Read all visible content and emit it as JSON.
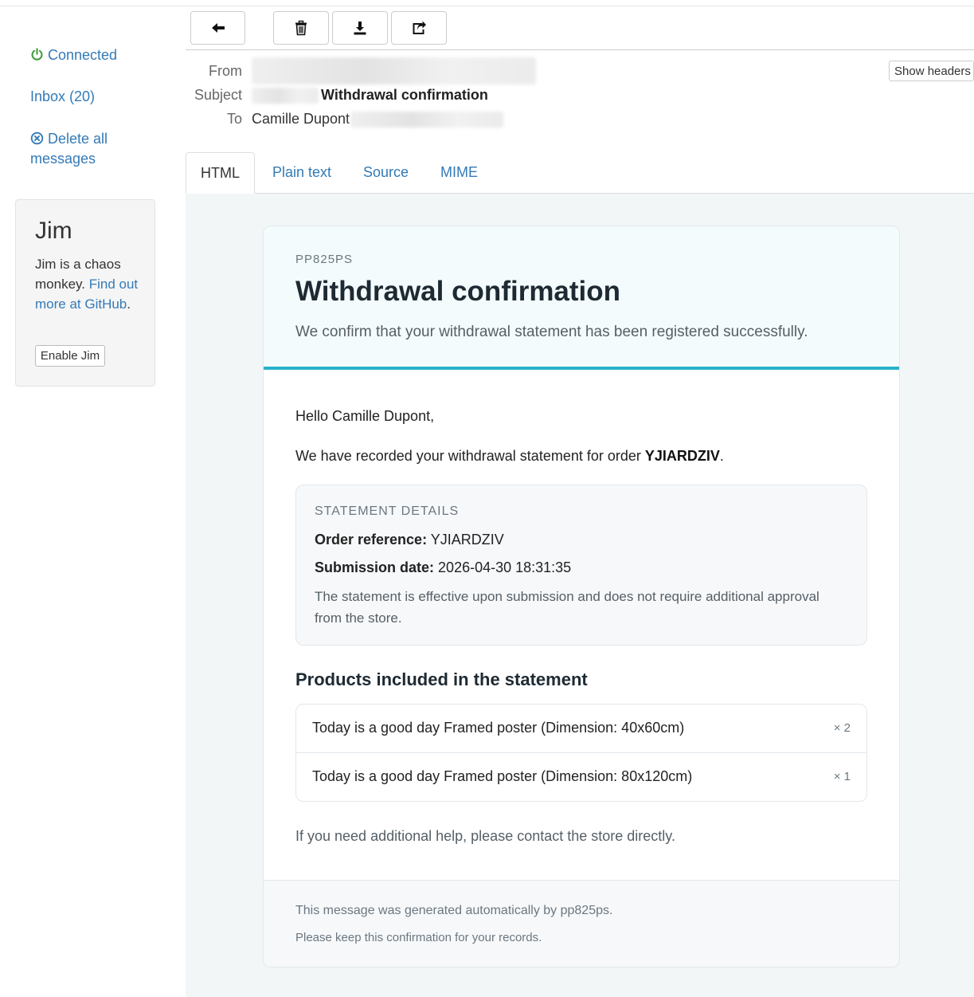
{
  "sidebar": {
    "connected": "Connected",
    "inbox": "Inbox (20)",
    "delete_all": "Delete all messages",
    "jim": {
      "title": "Jim",
      "desc": "Jim is a chaos monkey.",
      "link": "Find out more at GitHub",
      "link_suffix": ".",
      "button": "Enable Jim"
    }
  },
  "toolbar": {
    "back_icon": "arrow-left-icon",
    "delete_icon": "trash-icon",
    "download_icon": "download-icon",
    "share_icon": "share-icon"
  },
  "headers": {
    "from_label": "From",
    "subject_label": "Subject",
    "to_label": "To",
    "subject": "Withdrawal confirmation",
    "to_name": "Camille Dupont",
    "show_headers": "Show headers"
  },
  "tabs": [
    {
      "label": "HTML",
      "active": true
    },
    {
      "label": "Plain text",
      "active": false
    },
    {
      "label": "Source",
      "active": false
    },
    {
      "label": "MIME",
      "active": false
    }
  ],
  "email": {
    "brand": "PP825PS",
    "title": "Withdrawal confirmation",
    "lead": "We confirm that your withdrawal statement has been registered successfully.",
    "greeting": "Hello Camille Dupont,",
    "recorded_prefix": "We have recorded your withdrawal statement for order ",
    "order_code": "YJIARDZIV",
    "recorded_suffix": ".",
    "details": {
      "title": "STATEMENT DETAILS",
      "order_label": "Order reference:",
      "order_value": "YJIARDZIV",
      "date_label": "Submission date:",
      "date_value": "2026-04-30 18:31:35",
      "note": "The statement is effective upon submission and does not require additional approval from the store."
    },
    "products_title": "Products included in the statement",
    "products": [
      {
        "name": "Today is a good day Framed poster (Dimension: 40x60cm)",
        "qty": "× 2"
      },
      {
        "name": "Today is a good day Framed poster (Dimension: 80x120cm)",
        "qty": "× 1"
      }
    ],
    "help": "If you need additional help, please contact the store directly.",
    "footer_line1": "This message was generated automatically by pp825ps.",
    "footer_line2": "Please keep this confirmation for your records."
  },
  "colors": {
    "link": "#337ab7",
    "connected": "#3c9b3c",
    "accent": "#29b2c8"
  }
}
